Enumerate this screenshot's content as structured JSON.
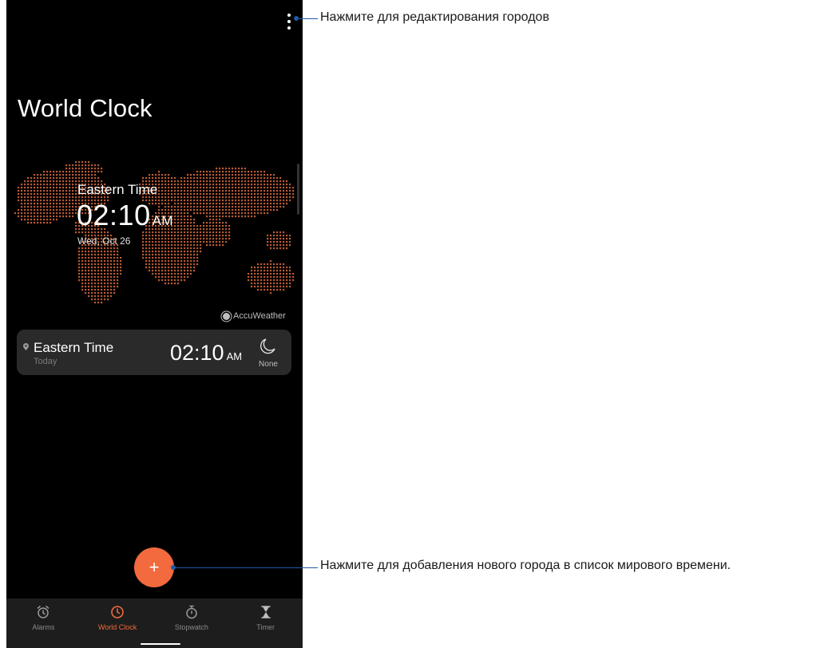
{
  "header": {
    "title": "World Clock",
    "menu_icon": "more-vert-icon"
  },
  "hero": {
    "city": "Eastern Time",
    "time": "02:10",
    "ampm": "AM",
    "date": "Wed, Oct 26",
    "provider": "AccuWeather"
  },
  "cities": [
    {
      "name": "Eastern Time",
      "day": "Today",
      "time": "02:10",
      "ampm": "AM",
      "weather_icon": "moon-icon",
      "weather": "None"
    }
  ],
  "fab": {
    "label": "+",
    "icon": "add-icon"
  },
  "nav": {
    "tabs": [
      {
        "label": "Alarms",
        "icon": "alarm-clock-icon",
        "active": false
      },
      {
        "label": "World Clock",
        "icon": "clock-icon",
        "active": true
      },
      {
        "label": "Stopwatch",
        "icon": "stopwatch-icon",
        "active": false
      },
      {
        "label": "Timer",
        "icon": "hourglass-icon",
        "active": false
      }
    ]
  },
  "callouts": {
    "edit_cities": "Нажмите для редактирования городов",
    "add_city": "Нажмите для добавления нового города в список мирового времени."
  },
  "colors": {
    "accent": "#f26a3d",
    "background": "#000000",
    "card": "#2a2a2a",
    "nav_bar": "#1d1d1d",
    "callout_line": "#1f5aa6",
    "map_dots": "#b85a36"
  }
}
